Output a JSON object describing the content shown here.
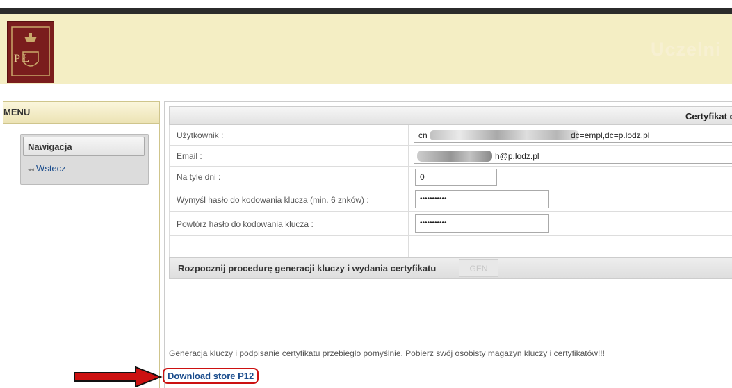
{
  "header": {
    "logo_text": "P Ł",
    "title": "Uczelni"
  },
  "menu": {
    "title": "MENU",
    "nav": {
      "title": "Nawigacja",
      "back_label": "Wstecz",
      "back_icon": "double-left-arrow-icon"
    }
  },
  "certificate": {
    "title": "Certyfikat dla:",
    "rows": [
      {
        "label": "Użytkownik :",
        "value": "dc=empl,dc=p.lodz.pl",
        "value_prefix": "cn"
      },
      {
        "label": "Email :",
        "value": "h@p.lodz.pl"
      },
      {
        "label": "Na tyle dni :",
        "value": "0"
      },
      {
        "label": "Wymyśl hasło do kodowania klucza (min. 6 znków) :",
        "value": "•••••••••••"
      },
      {
        "label": "Powtórz hasło do kodowania klucza :",
        "value": "•••••••••••"
      }
    ],
    "generate_label": "Rozpocznij procedurę generacji kluczy i wydania certyfikatu",
    "generate_button": "GEN"
  },
  "result": {
    "success_message": "Generacja kluczy i podpisanie certyfikatu przebiegło pomyślnie. Pobierz swój osobisty magazyn kluczy i certyfikatów!!!",
    "download_label": "Download store P12"
  },
  "colors": {
    "header_bg": "#f4eec4",
    "logo_bg": "#7a1d1d",
    "link": "#1a4c8c",
    "highlight_red": "#cc1111"
  }
}
